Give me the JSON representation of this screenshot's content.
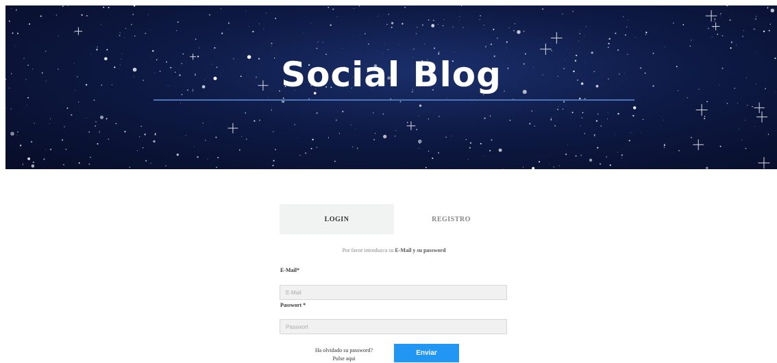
{
  "header": {
    "title": "Social Blog"
  },
  "tabs": {
    "login": "LOGIN",
    "registro": "REGISTRO"
  },
  "hint": {
    "prefix": "Por favor introduzca su",
    "emphasis": "E-Mail y su password"
  },
  "form": {
    "email_label": "E-Mail*",
    "email_placeholder": "E-Mail",
    "password_label": "Passwort *",
    "password_placeholder": "Passwort",
    "forgot_line1": "Ha olvidado su password?",
    "forgot_line2": "Pulse aqui",
    "submit_label": "Enviar"
  },
  "colors": {
    "accent": "#2196f3",
    "hero_bg": "#0e1a45",
    "hero_rule": "#4d74b8"
  }
}
